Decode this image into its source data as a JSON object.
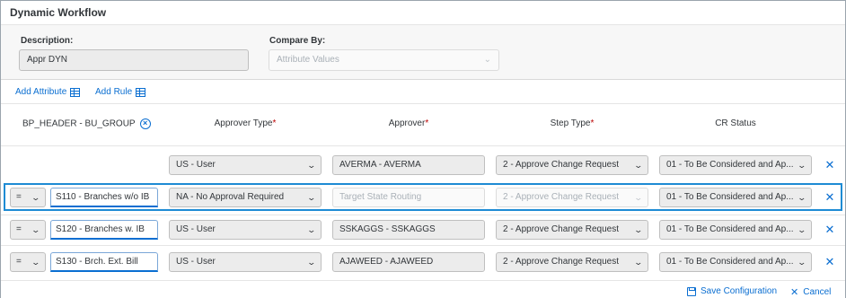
{
  "app": {
    "title": "Dynamic Workflow"
  },
  "header": {
    "description_label": "Description:",
    "description_value": "Appr DYN",
    "compare_label": "Compare By:",
    "compare_placeholder": "Attribute Values"
  },
  "toolbar": {
    "add_attribute": "Add Attribute",
    "add_rule": "Add Rule"
  },
  "columns": {
    "attribute": "BP_HEADER - BU_GROUP",
    "approver_type": "Approver Type",
    "approver": "Approver",
    "step_type": "Step Type",
    "cr_status": "CR Status",
    "required_mark": "*"
  },
  "rows": [
    {
      "operator": "",
      "value": "",
      "approver_type": "US - User",
      "approver": "AVERMA - AVERMA",
      "step_type": "2 - Approve Change Request",
      "cr_status": "01 - To Be Considered and Ap...",
      "selected": false
    },
    {
      "operator": "=",
      "value": "S110 - Branches w/o IB",
      "approver_type": "NA - No Approval Required",
      "approver": "Target State Routing",
      "step_type": "2 - Approve Change Request",
      "cr_status": "01 - To Be Considered and Ap...",
      "selected": true
    },
    {
      "operator": "=",
      "value": "S120 - Branches w. IB",
      "approver_type": "US - User",
      "approver": "SSKAGGS - SSKAGGS",
      "step_type": "2 - Approve Change Request",
      "cr_status": "01 - To Be Considered and Ap...",
      "selected": false
    },
    {
      "operator": "=",
      "value": "S130 - Brch. Ext. Bill",
      "approver_type": "US - User",
      "approver": "AJAWEED - AJAWEED",
      "step_type": "2 - Approve Change Request",
      "cr_status": "01 - To Be Considered and Ap...",
      "selected": false
    }
  ],
  "footer": {
    "save": "Save Configuration",
    "cancel": "Cancel"
  },
  "colors": {
    "accent": "#0a6ed1",
    "selection": "#1e8bd4",
    "required": "#bb0000"
  },
  "icons": {
    "add_attribute": "table-grid-icon",
    "add_rule": "table-grid-icon",
    "remove_attribute": "circle-x-icon",
    "row_delete": "close-icon",
    "dropdown": "chevron-down-icon",
    "save": "save-icon",
    "cancel": "close-icon"
  }
}
